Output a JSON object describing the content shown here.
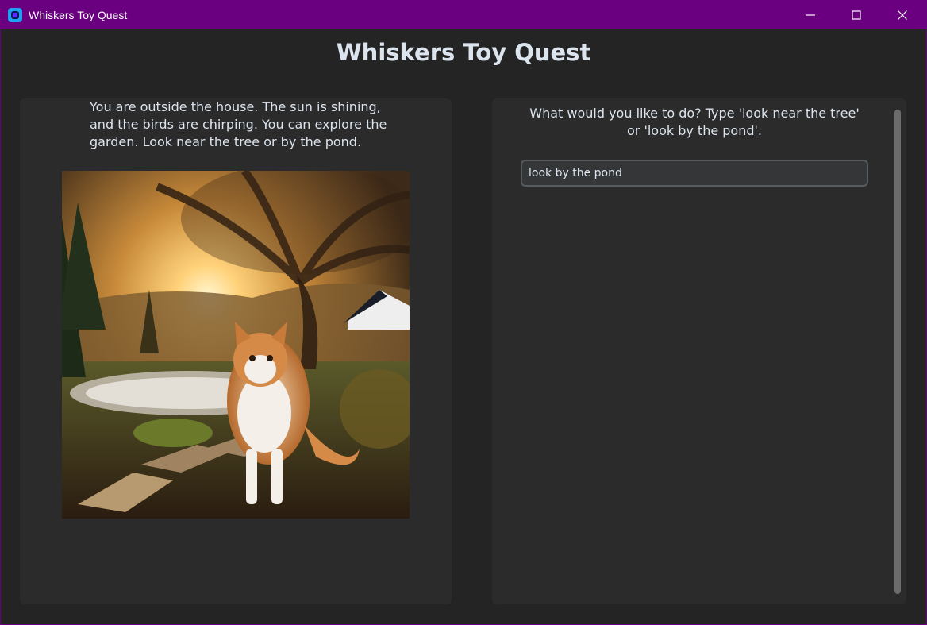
{
  "window": {
    "title": "Whiskers Toy Quest",
    "icons": [
      "app-icon",
      "minimize-icon",
      "maximize-icon",
      "close-icon"
    ],
    "accent_color": "#6a0080"
  },
  "game": {
    "heading": "Whiskers Toy Quest",
    "story": "You are outside the house. The sun is shining, and the birds are chirping. You can explore the garden. Look near the tree or by the pond.",
    "prompt": "What would you like to do? Type 'look near the tree' or 'look by the pond'.",
    "command_value": "look by the pond"
  }
}
